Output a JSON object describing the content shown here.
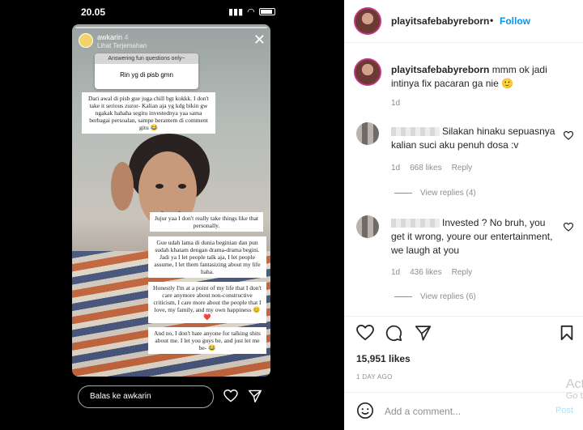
{
  "statusbar": {
    "time": "20.05"
  },
  "story": {
    "username": "awkarin",
    "age": "4",
    "subtitle": "Lihat Terjemahan",
    "question_header": "Answering fun questions only~",
    "question": "Rin yg di pisb gmn",
    "notes": [
      "Dari awal di pisb gue juga chill bgt kokkk. I don't take it serious zuzor- Kalian aja yg kdg bikin gw ngakak hahaha segitu investednya yaa sama berbagai persoalan, sampe berantem di comment gitu 😂",
      "Jujur yaa I don't really take things like that personally.",
      "Gue udah lama di dunia beginian dan pun sudah khatam dengan drama-drama begini. Jadi ya I let people talk aja, I let people assume, I let them fantasizing about my life haha.",
      "Honestly I'm at a point of my life that I don't care anymore about non-constructive criticism, I care more about the people that I love, my family, and my own happiness 😊❤️",
      "And no, I don't hate anyone for talking shits about me. I let you guys be, and just let me be- 😂"
    ],
    "reply_placeholder": "Balas ke awkarin"
  },
  "post": {
    "username": "playitsafebabyreborn",
    "follow_label": "Follow",
    "caption": "mmm ok jadi intinya fix pacaran ga nie 🙂",
    "caption_time": "1d",
    "comments": [
      {
        "text": "Silakan hinaku sepuasnya kalian suci aku penuh dosa :v",
        "time": "1d",
        "likes": "668 likes",
        "reply": "Reply",
        "view_replies": "View replies (4)"
      },
      {
        "text": "Invested ? No bruh, you get it wrong, youre our entertainment, we laugh at you",
        "time": "1d",
        "likes": "436 likes",
        "reply": "Reply",
        "view_replies": "View replies (6)"
      }
    ],
    "like_count": "15,951 likes",
    "date": "1 DAY AGO",
    "add_comment_placeholder": "Add a comment...",
    "post_label": "Post"
  },
  "watermark": {
    "line1": "Act",
    "line2": "Go t"
  },
  "icons": {
    "heart": "heart-icon",
    "comment": "comment-icon",
    "share": "share-icon",
    "save": "bookmark-icon",
    "emoji": "emoji-icon"
  },
  "colors": {
    "accent": "#0095f6",
    "muted": "#8e8e8e",
    "text": "#262626"
  }
}
